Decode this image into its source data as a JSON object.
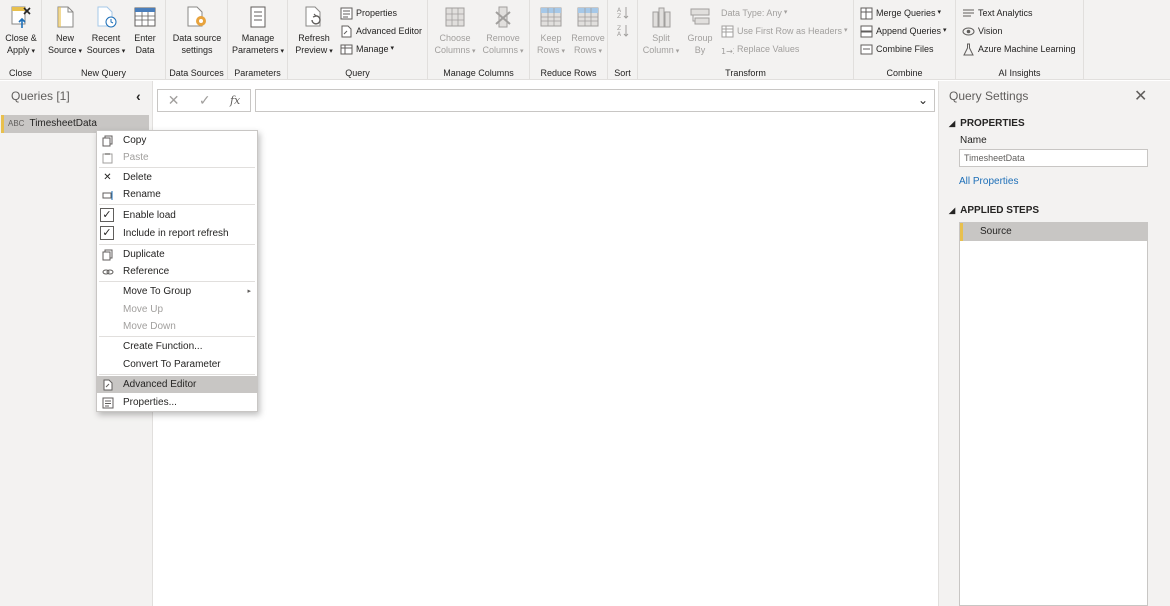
{
  "ribbon": {
    "close": {
      "close_apply": "Close &",
      "close_apply2": "Apply",
      "label": "Close"
    },
    "new_query": {
      "new_source": "New",
      "new_source2": "Source",
      "recent_sources": "Recent",
      "recent_sources2": "Sources",
      "enter_data": "Enter",
      "enter_data2": "Data",
      "label": "New Query"
    },
    "data_sources": {
      "settings": "Data source",
      "settings2": "settings",
      "label": "Data Sources"
    },
    "parameters": {
      "manage": "Manage",
      "manage2": "Parameters",
      "label": "Parameters"
    },
    "query": {
      "refresh": "Refresh",
      "refresh2": "Preview",
      "properties": "Properties",
      "advanced_editor": "Advanced Editor",
      "manage": "Manage",
      "label": "Query"
    },
    "manage_columns": {
      "choose": "Choose",
      "choose2": "Columns",
      "remove": "Remove",
      "remove2": "Columns",
      "label": "Manage Columns"
    },
    "reduce_rows": {
      "keep": "Keep",
      "keep2": "Rows",
      "remove": "Remove",
      "remove2": "Rows",
      "label": "Reduce Rows"
    },
    "sort": {
      "label": "Sort"
    },
    "transform": {
      "split": "Split",
      "split2": "Column",
      "group": "Group",
      "group2": "By",
      "data_type": "Data Type: Any",
      "first_row": "Use First Row as Headers",
      "replace": "Replace Values",
      "label": "Transform"
    },
    "combine": {
      "merge": "Merge Queries",
      "append": "Append Queries",
      "combine_files": "Combine Files",
      "label": "Combine"
    },
    "ai": {
      "text": "Text Analytics",
      "vision": "Vision",
      "azure_ml": "Azure Machine Learning",
      "label": "AI Insights"
    }
  },
  "queries_pane": {
    "title": "Queries [1]",
    "items": [
      {
        "name": "TimesheetData",
        "type_icon": "ABC"
      }
    ]
  },
  "context_menu": {
    "copy": "Copy",
    "paste": "Paste",
    "delete": "Delete",
    "rename": "Rename",
    "enable_load": "Enable load",
    "include_refresh": "Include in report refresh",
    "duplicate": "Duplicate",
    "reference": "Reference",
    "move_to_group": "Move To Group",
    "move_up": "Move Up",
    "move_down": "Move Down",
    "create_function": "Create Function...",
    "convert_param": "Convert To Parameter",
    "advanced_editor": "Advanced Editor",
    "properties": "Properties..."
  },
  "query_settings": {
    "title": "Query Settings",
    "properties_head": "PROPERTIES",
    "name_label": "Name",
    "name_value": "TimesheetData",
    "all_properties": "All Properties",
    "steps_head": "APPLIED STEPS",
    "steps": [
      {
        "name": "Source"
      }
    ]
  },
  "colors": {
    "accent": "#e8c04e",
    "selection": "#c8c6c4",
    "link": "#1d6fb8"
  }
}
